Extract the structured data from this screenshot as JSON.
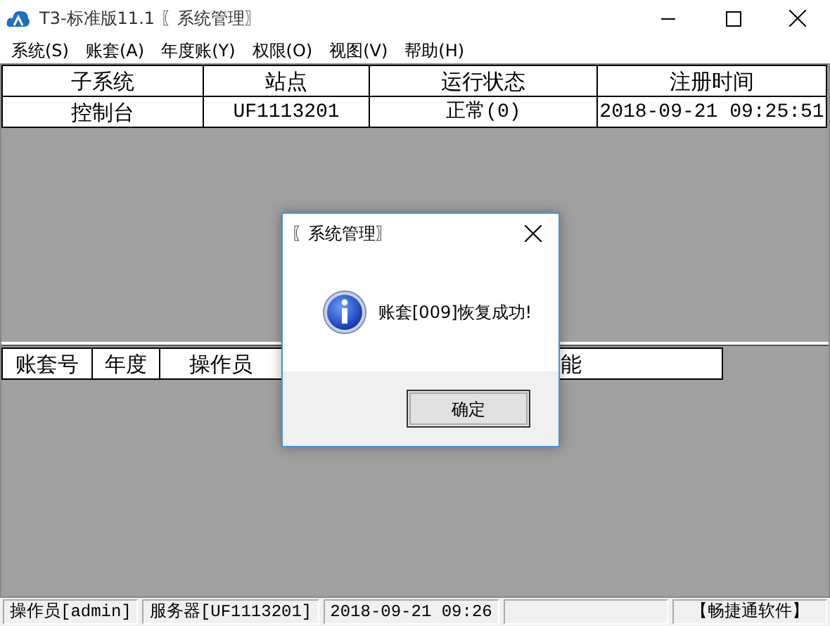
{
  "window": {
    "title": "T3-标准版11.1 〖系统管理〗"
  },
  "menu": [
    {
      "label": "系统(S)"
    },
    {
      "label": "账套(A)"
    },
    {
      "label": "年度账(Y)"
    },
    {
      "label": "权限(O)"
    },
    {
      "label": "视图(V)"
    },
    {
      "label": "帮助(H)"
    }
  ],
  "upper_table": {
    "columns": [
      "子系统",
      "站点",
      "运行状态",
      "注册时间"
    ],
    "rows": [
      [
        "控制台",
        "UF1113201",
        "正常(0)",
        "2018-09-21 09:25:51"
      ]
    ]
  },
  "lower_table": {
    "columns": [
      "账套号",
      "年度",
      "操作员",
      "能"
    ]
  },
  "dialog": {
    "title": "〖系统管理〗",
    "message": "账套[009]恢复成功!",
    "button": "确定"
  },
  "status_bar": [
    {
      "text": "操作员[admin]"
    },
    {
      "text": "服务器[UF1113201]"
    },
    {
      "text": "2018-09-21 09:26"
    },
    {
      "text": "【畅捷通软件】"
    }
  ]
}
